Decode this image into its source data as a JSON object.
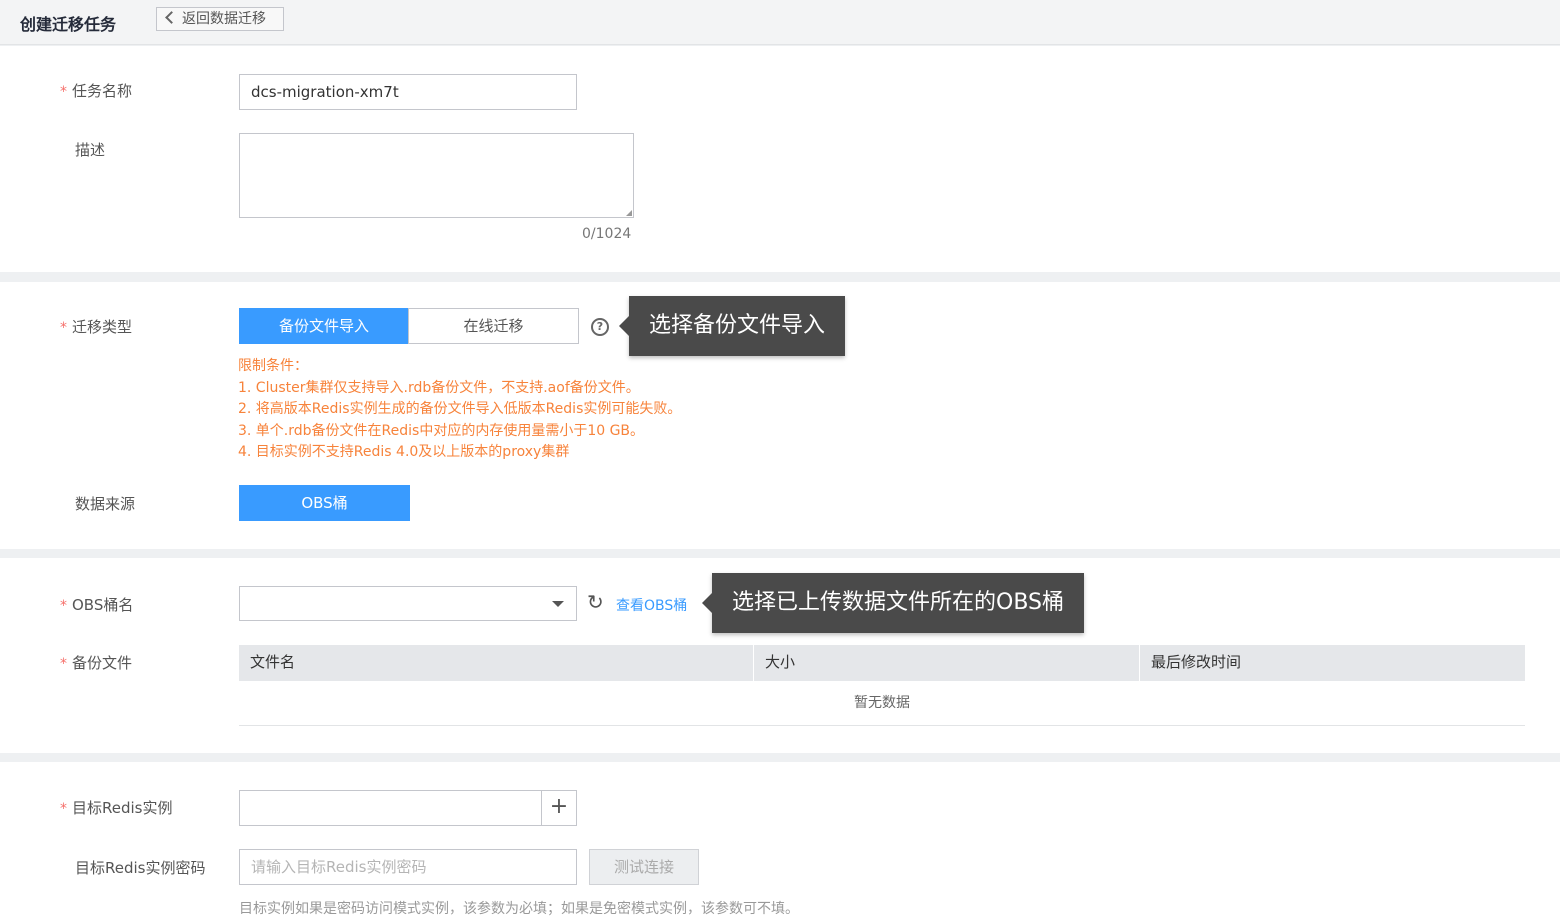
{
  "header": {
    "title": "创建迁移任务",
    "back_label": "返回数据迁移"
  },
  "basic": {
    "name_label": "任务名称",
    "name_value": "dcs-migration-xm7t",
    "desc_label": "描述",
    "desc_counter": "0/1024"
  },
  "migration": {
    "type_label": "迁移类型",
    "options": [
      "备份文件导入",
      "在线迁移"
    ],
    "selected": "备份文件导入",
    "help_icon": "question-circle-icon",
    "tooltip": "选择备份文件导入",
    "restrictions": [
      "限制条件：",
      "1. Cluster集群仅支持导入.rdb备份文件，不支持.aof备份文件。",
      "2. 将高版本Redis实例生成的备份文件导入低版本Redis实例可能失败。",
      "3. 单个.rdb备份文件在Redis中对应的内存使用量需小于10 GB。",
      "4. 目标实例不支持Redis 4.0及以上版本的proxy集群"
    ],
    "source_label": "数据来源",
    "source_value": "OBS桶"
  },
  "obs": {
    "bucket_label": "OBS桶名",
    "bucket_value": "",
    "view_link": "查看OBS桶",
    "tooltip": "选择已上传数据文件所在的OBS桶",
    "backup_label": "备份文件",
    "columns": [
      "文件名",
      "大小",
      "最后修改时间"
    ],
    "empty_text": "暂无数据"
  },
  "target": {
    "instance_label": "目标Redis实例",
    "instance_value": "",
    "password_label": "目标Redis实例密码",
    "password_placeholder": "请输入目标Redis实例密码",
    "test_button": "测试连接",
    "hint": "目标实例如果是密码访问模式实例，该参数为必填；如果是免密模式实例，该参数可不填。"
  },
  "colors": {
    "primary": "#399bff",
    "warning": "#f7833b",
    "required": "#f66f6a",
    "tooltip_bg": "#4a4a4a"
  }
}
